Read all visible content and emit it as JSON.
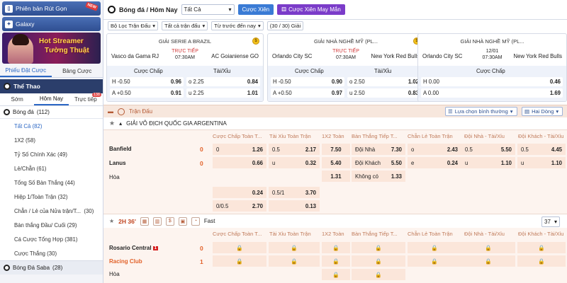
{
  "sidebar": {
    "short_version_label": "Phiên bản Rút Gọn",
    "new_tag": "NEW",
    "galaxy_label": "Galaxy",
    "banner_line1": "Hot Streamer",
    "banner_line2": "Tường Thuật",
    "tab_bet_slip": "Phiếu Đặt Cược",
    "tab_bet_list": "Bảng Cược",
    "sports_header": "Thể Thao",
    "subtab_early": "Sớm",
    "subtab_today": "Hôm Nay",
    "subtab_live": "Trực tiếp",
    "live_count": "138",
    "football_label": "Bóng đá",
    "football_count": "(112)",
    "items": [
      {
        "label": "Tất Cả",
        "count": "(82)"
      },
      {
        "label": "1X2",
        "count": "(58)"
      },
      {
        "label": "Tỷ Số Chính Xác",
        "count": "(49)"
      },
      {
        "label": "Lẻ/Chẵn",
        "count": "(61)"
      },
      {
        "label": "Tổng Số Bàn Thắng",
        "count": "(44)"
      },
      {
        "label": "Hiệp 1/Toàn Trận",
        "count": "(32)"
      },
      {
        "label": "Chẵn / Lẻ của Nửa trận/T...",
        "count": "(30)"
      },
      {
        "label": "Bàn thắng Đầu/ Cuối",
        "count": "(29)"
      },
      {
        "label": "Cá Cược Tổng Hợp",
        "count": "(381)"
      },
      {
        "label": "Cược Thắng",
        "count": "(30)"
      }
    ],
    "saba_label": "Bóng Đá Saba",
    "saba_count": "(28)"
  },
  "topbar": {
    "title": "Bóng đá / Hôm Nay",
    "select_value": "Tất Cả",
    "parlay_button": "Cược Xiên",
    "lucky_parlay_button": "Cược Xiên May Mắn"
  },
  "filters": {
    "league_filter": "Bộ Lọc Trận Đấu",
    "match_filter": "Tất cả trận đấu",
    "sort_filter": "Từ trước đến nay",
    "count_label": "(30 / 30) Giải"
  },
  "cards": [
    {
      "league": "GIẢI SERIE A BRAZIL",
      "home": "Vasco da Gama RJ",
      "away": "AC Goianiense GO",
      "status": "TRỰC TIẾP",
      "time": "07:30AM",
      "market1": "Cược Chấp",
      "market2": "Tài/Xỉu",
      "r1": {
        "l": "H -0.50",
        "v": "0.96",
        "l2": "o 2.25",
        "v2": "0.84"
      },
      "r2": {
        "l": "A +0.50",
        "v": "0.91",
        "l2": "u 2.25",
        "v2": "1.01"
      }
    },
    {
      "league": "GIẢI NHÀ NGHỀ MỸ (PL...",
      "home": "Orlando City SC",
      "away": "New York Red Bulls",
      "status": "TRỰC TIẾP",
      "time": "07:30AM",
      "market1": "Cược Chấp",
      "market2": "Tài/Xỉu",
      "r1": {
        "l": "H -0.50",
        "v": "0.90",
        "l2": "o 2.50",
        "v2": "1.02"
      },
      "r2": {
        "l": "A +0.50",
        "v": "0.97",
        "l2": "u 2.50",
        "v2": "0.83"
      }
    },
    {
      "league": "GIẢI NHÀ NGHỀ MỸ (PL...",
      "home": "Orlando City SC",
      "away": "New York Red Bulls",
      "date": "12/01",
      "time": "07:30AM",
      "market1": "Cược Chấp",
      "r1": {
        "l": "H 0.00",
        "v": "0.46"
      },
      "r2": {
        "l": "A 0.00",
        "v": "1.69"
      }
    }
  ],
  "events": {
    "header": "Trận Đấu",
    "sort_select": "Lựa chọn bình thường",
    "view_select": "Hai Dòng",
    "league": "GIẢI VÔ ĐỊCH QUỐC GIA ARGENTINA",
    "columns": [
      "Cược Chấp Toàn T...",
      "Tài Xỉu Toàn Trận",
      "1X2 Toàn",
      "Bàn Thắng Tiếp T...",
      "Chẵn Lẻ Toàn Trận",
      "Đội Nhà - Tài/Xỉu",
      "Đội Khách - Tài/Xỉu"
    ],
    "match1": {
      "home": "Banfield",
      "away": "Lanus",
      "draw": "Hòa",
      "home_score": "0",
      "away_score": "0",
      "hc_home": "0",
      "hc_home_odds": "1.26",
      "hc_away_odds": "0.66",
      "ou_o": "0.5",
      "ou_o_odds": "2.17",
      "ou_u": "u",
      "ou_u_odds": "0.32",
      "x_home": "7.50",
      "x_away": "5.40",
      "x_draw": "1.31",
      "ng_home": "Đội Nhà",
      "ng_home_odds": "7.30",
      "ng_away": "Đội Khách",
      "ng_away_odds": "5.50",
      "ng_none": "Không có",
      "ng_none_odds": "1.33",
      "oe_o": "o",
      "oe_o_odds": "2.43",
      "oe_e": "e",
      "oe_e_odds": "0.24",
      "hou_o": "0.5",
      "hou_o_odds": "5.50",
      "hou_u": "u",
      "hou_u_odds": "1.10",
      "aou_o": "0.5",
      "aou_o_odds": "4.45",
      "aou_u": "u",
      "aou_u_odds": "1.10",
      "alt_hc_odds1": "0.24",
      "alt_hc_line2": "0/0.5",
      "alt_hc_odds2": "2.70",
      "alt_ou_line1": "0.5/1",
      "alt_ou_odds1": "3.70",
      "alt_ou_odds2": "0.13"
    },
    "live_time": "2H 36'",
    "fast_label": "Fast",
    "page_select": "37",
    "match2": {
      "home": "Rosario Central",
      "home_red": "1",
      "away": "Racing Club",
      "draw": "Hòa",
      "home_score": "0",
      "away_score": "1"
    }
  }
}
